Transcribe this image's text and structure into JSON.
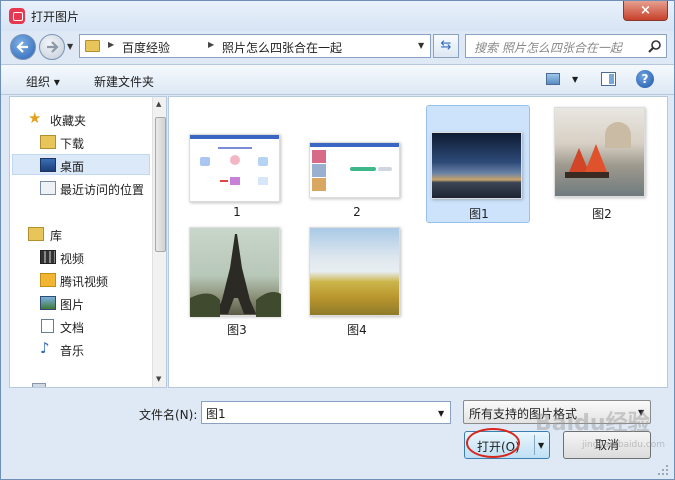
{
  "window": {
    "title": "打开图片",
    "close_label": "×"
  },
  "nav": {
    "breadcrumbs": [
      "百度经验",
      "照片怎么四张合在一起"
    ]
  },
  "search": {
    "placeholder": "搜索 照片怎么四张合在一起"
  },
  "toolbar": {
    "organize_label": "组织 ▾",
    "new_folder_label": "新建文件夹"
  },
  "sidebar": {
    "favorites_label": "收藏夹",
    "favorites": [
      "下载",
      "桌面",
      "最近访问的位置"
    ],
    "libraries_label": "库",
    "libraries": [
      "视频",
      "腾讯视频",
      "图片",
      "文档",
      "音乐"
    ],
    "selected": "桌面"
  },
  "files": [
    {
      "name": "1",
      "kind": "screenshot",
      "selected": false
    },
    {
      "name": "2",
      "kind": "screenshot",
      "selected": false
    },
    {
      "name": "图1",
      "kind": "sunset",
      "selected": true
    },
    {
      "name": "图2",
      "kind": "venice",
      "selected": false
    },
    {
      "name": "图3",
      "kind": "eiffel",
      "selected": false
    },
    {
      "name": "图4",
      "kind": "field",
      "selected": false
    }
  ],
  "bottom": {
    "filename_label": "文件名(N):",
    "filename_value": "图1",
    "filter_value": "所有支持的图片格式",
    "open_label": "打开(O)",
    "cancel_label": "取消"
  },
  "watermark": {
    "text": "Baidu经验",
    "sub": "jingyan.baidu.com"
  },
  "colors": {
    "accent": "#2a63b6",
    "selection": "#cde3fb",
    "annotation": "#d8261c"
  }
}
